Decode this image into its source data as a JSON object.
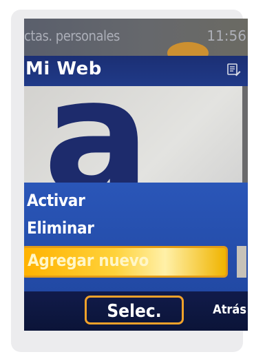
{
  "status_bar": {
    "title": "ctas. personales",
    "time": "11:56"
  },
  "header": {
    "title": "Mi Web",
    "icon": "edit-icon"
  },
  "content": {
    "logo_letter": "a"
  },
  "menu": {
    "items": [
      {
        "label": "Activar"
      },
      {
        "label": "Eliminar"
      },
      {
        "label": "Agregar nuevo",
        "selected": true
      }
    ]
  },
  "softkeys": {
    "select_label": "Selec.",
    "back_label": "Atrás"
  },
  "colors": {
    "menu_bg": "#2a56b8",
    "highlight": "#ffc21a",
    "highlight_border": "#e39b17"
  }
}
